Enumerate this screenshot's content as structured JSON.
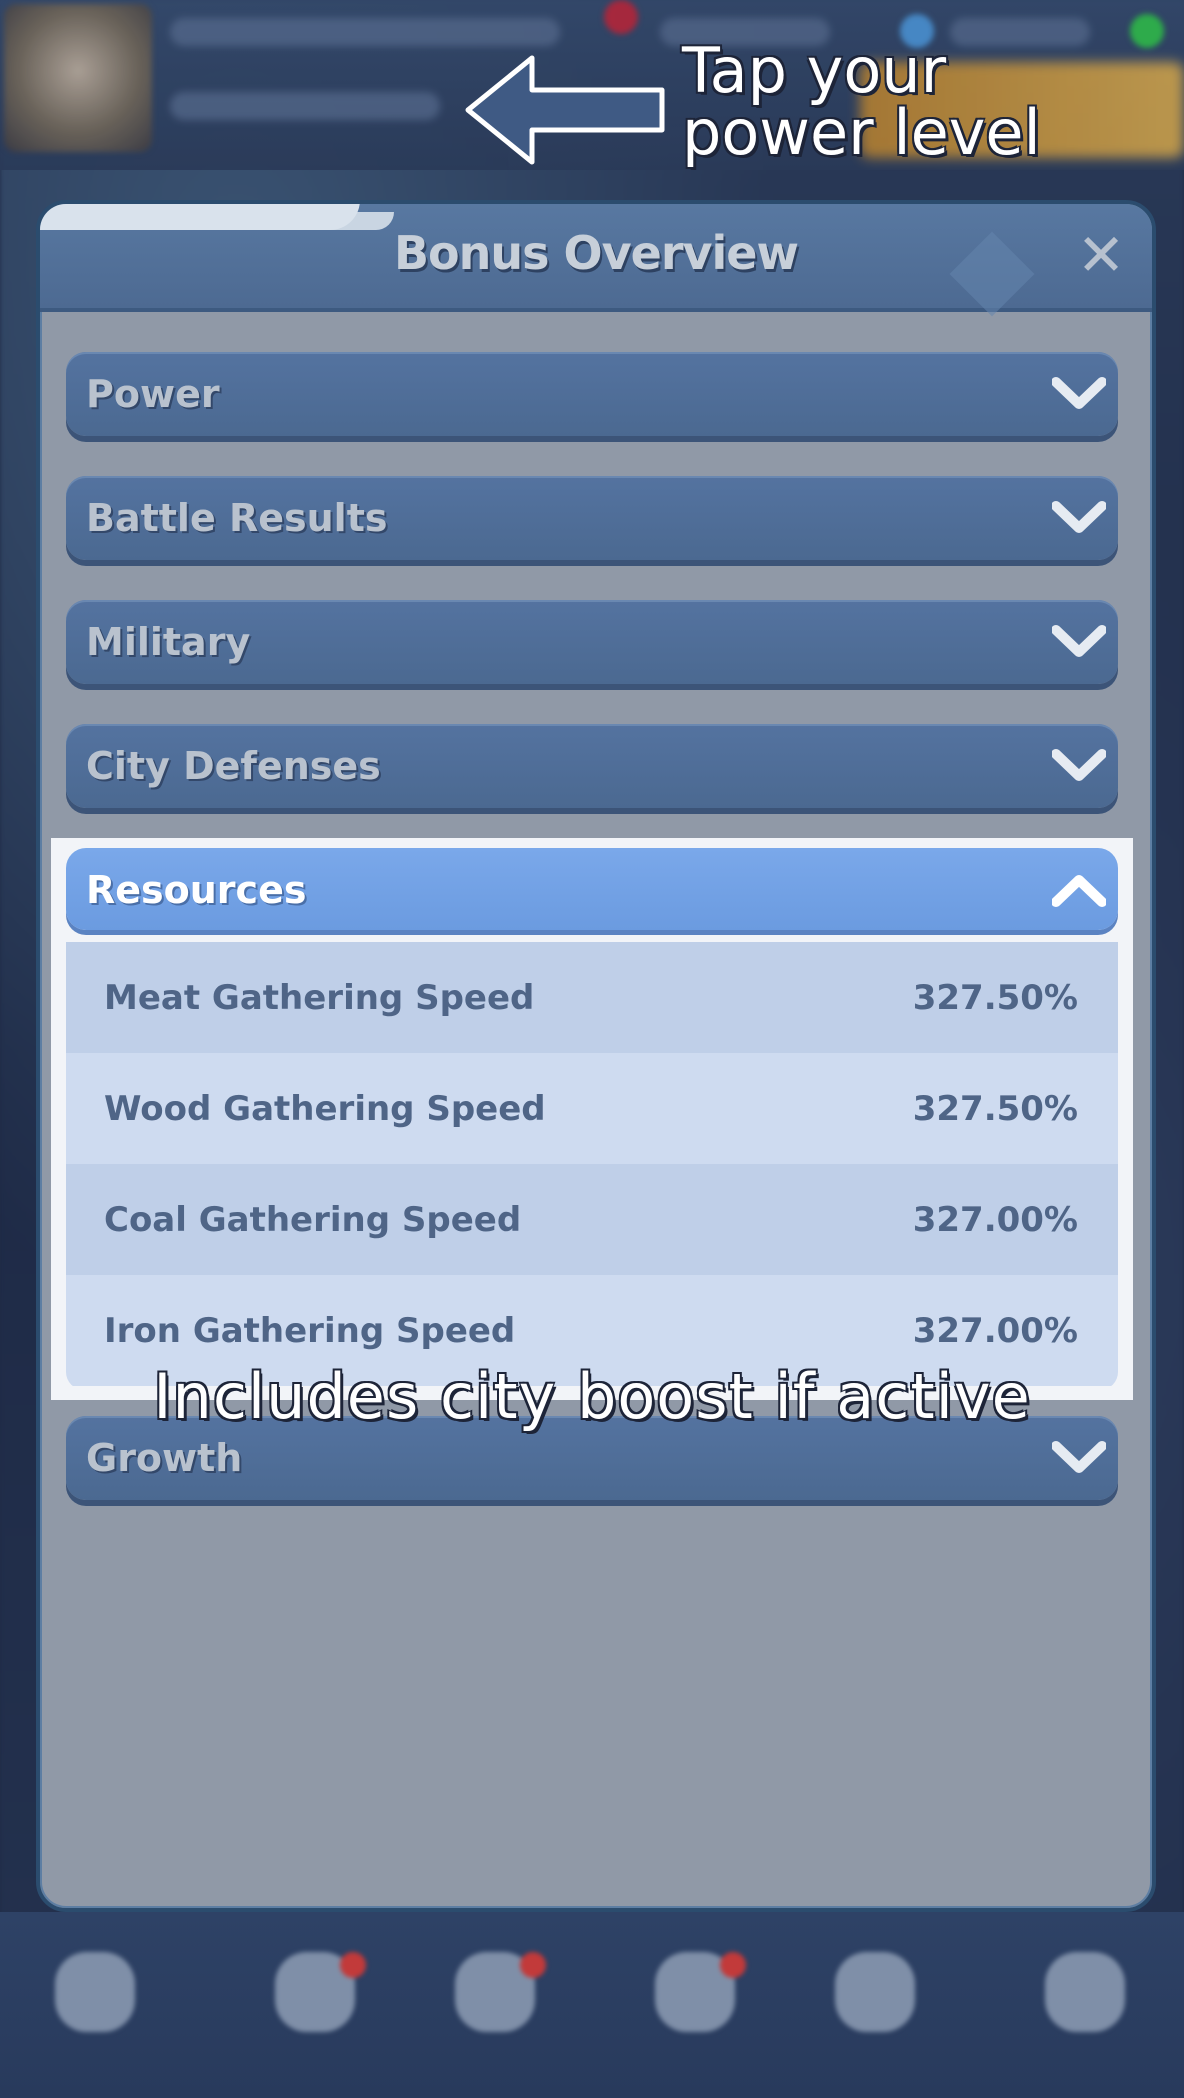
{
  "annotations": {
    "top_line1": "Tap your",
    "top_line2": "power level",
    "bottom": "Includes city boost if active"
  },
  "dialog": {
    "title": "Bonus Overview",
    "close_icon": "close-icon"
  },
  "sections": [
    {
      "label": "Power",
      "state": "collapsed"
    },
    {
      "label": "Battle Results",
      "state": "collapsed"
    },
    {
      "label": "Military",
      "state": "collapsed"
    },
    {
      "label": "City Defenses",
      "state": "collapsed"
    },
    {
      "label": "Resources",
      "state": "expanded"
    },
    {
      "label": "Growth",
      "state": "collapsed"
    }
  ],
  "resources": [
    {
      "name": "Meat Gathering Speed",
      "value": "327.50%"
    },
    {
      "name": "Wood Gathering Speed",
      "value": "327.50%"
    },
    {
      "name": "Coal Gathering Speed",
      "value": "327.00%"
    },
    {
      "name": "Iron Gathering Speed",
      "value": "327.00%"
    }
  ],
  "colors": {
    "panel_bg": "#9099a7",
    "section_bg": "#4b6991",
    "expanded_header": "#7aa8ea",
    "row_text": "#4f6587"
  }
}
